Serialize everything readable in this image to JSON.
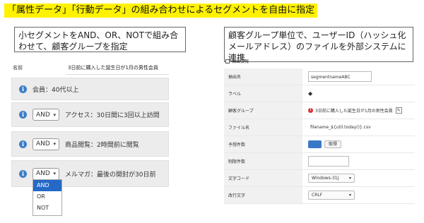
{
  "title": "「属性データ」「行動データ」の組み合わせによるセグメントを自由に指定",
  "callout_left": "小セグメントをAND、OR、NOTで組み合わせて、顧客グループを指定",
  "callout_right": "顧客グループ単位で、ユーザーID（ハッシュ化メールアドレス）のファイルを外部システムに連携",
  "left_panel": {
    "name_label": "名前",
    "name_value": "3日前に購入した誕生日が1月の男性会員",
    "segments": [
      {
        "text": "会員：40代以上"
      },
      {
        "operator": "AND",
        "text": "アクセス：30日間に3回以上訪問"
      },
      {
        "operator": "AND",
        "text": "商品閲覧：2時間前に閲覧"
      },
      {
        "operator": "AND",
        "text": "メルマガ：最後の開封が30日前"
      }
    ],
    "dropdown_options": [
      "AND",
      "OR",
      "NOT"
    ],
    "dropdown_selected": "AND"
  },
  "right_panel": {
    "checkbox_label": "抽出情報",
    "rows": {
      "extract_name": {
        "label": "抽出名",
        "value": "segmentnameABC"
      },
      "labels": {
        "label": "ラベル"
      },
      "customer_group": {
        "label": "顧客グループ",
        "value": "3日前に購入した誕生日が1月の男性会員"
      },
      "file_name": {
        "label": "ファイル名",
        "value": "filename_${util.today()}.csv"
      },
      "expected_count": {
        "label": "予想件数",
        "button": "取得"
      },
      "limit_count": {
        "label": "制限件数"
      },
      "char_code": {
        "label": "文字コード",
        "value": "Windows-31J"
      },
      "newline": {
        "label": "改行文字",
        "value": "CRLF"
      }
    }
  },
  "colors": {
    "highlight": "#fff200",
    "accent": "#2469c7"
  }
}
